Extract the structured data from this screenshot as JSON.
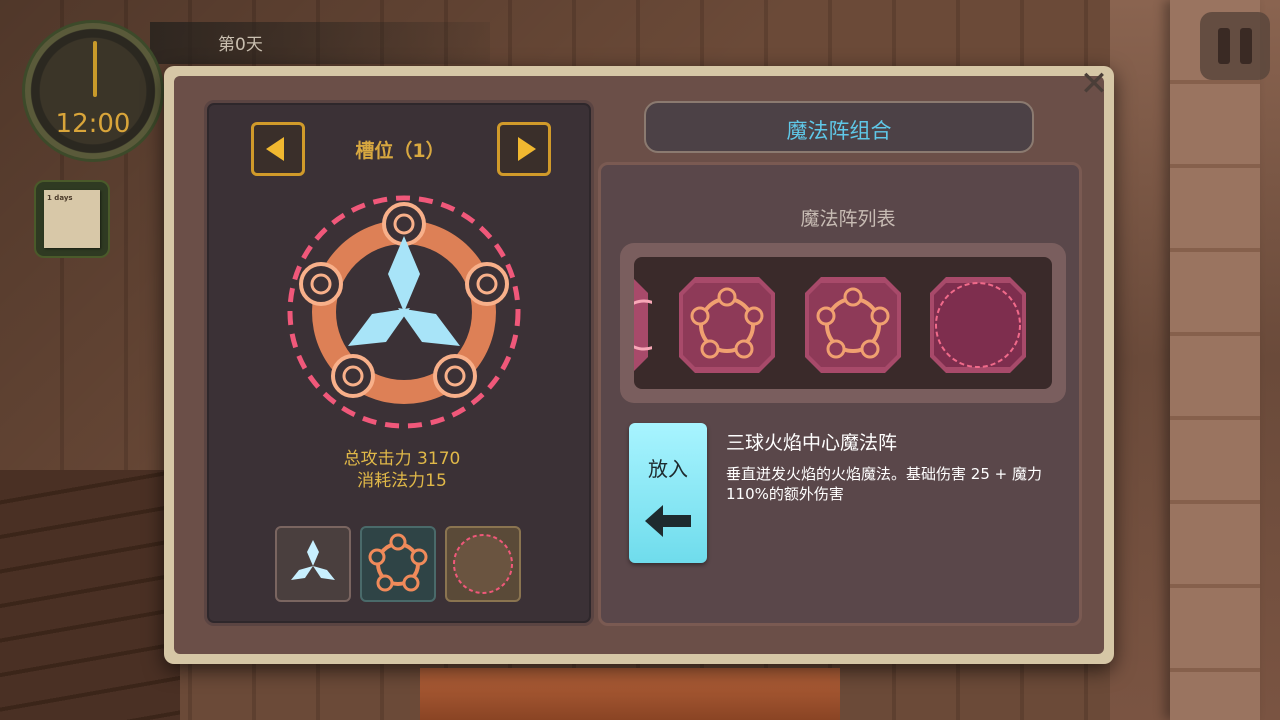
{
  "hud": {
    "clock_time": "12:00",
    "day_label": "第0天",
    "note_text": "1 days"
  },
  "dialog": {
    "close_label": "✕",
    "left": {
      "slot_title": "槽位（1）",
      "total_attack": "总攻击力 3170",
      "mana_cost": "消耗法力15"
    },
    "right": {
      "title": "魔法阵组合",
      "list_title": "魔法阵列表",
      "put_in_label": "放入",
      "spell_name": "三球火焰中心魔法阵",
      "spell_desc": "垂直迸发火焰的火焰魔法。基础伤害 25 + 魔力110%的额外伤害"
    }
  },
  "icons": {
    "prev": "triangle-left-icon",
    "next": "triangle-right-icon",
    "close": "close-icon",
    "pause": "pause-icon",
    "arrow": "arrow-left-icon"
  },
  "colors": {
    "accent_gold": "#e0b848",
    "title_cyan": "#5fc8e8",
    "put_button": "#8ae8f6",
    "rune_orange": "#f08a5a",
    "rune_pink": "#f0587a"
  }
}
